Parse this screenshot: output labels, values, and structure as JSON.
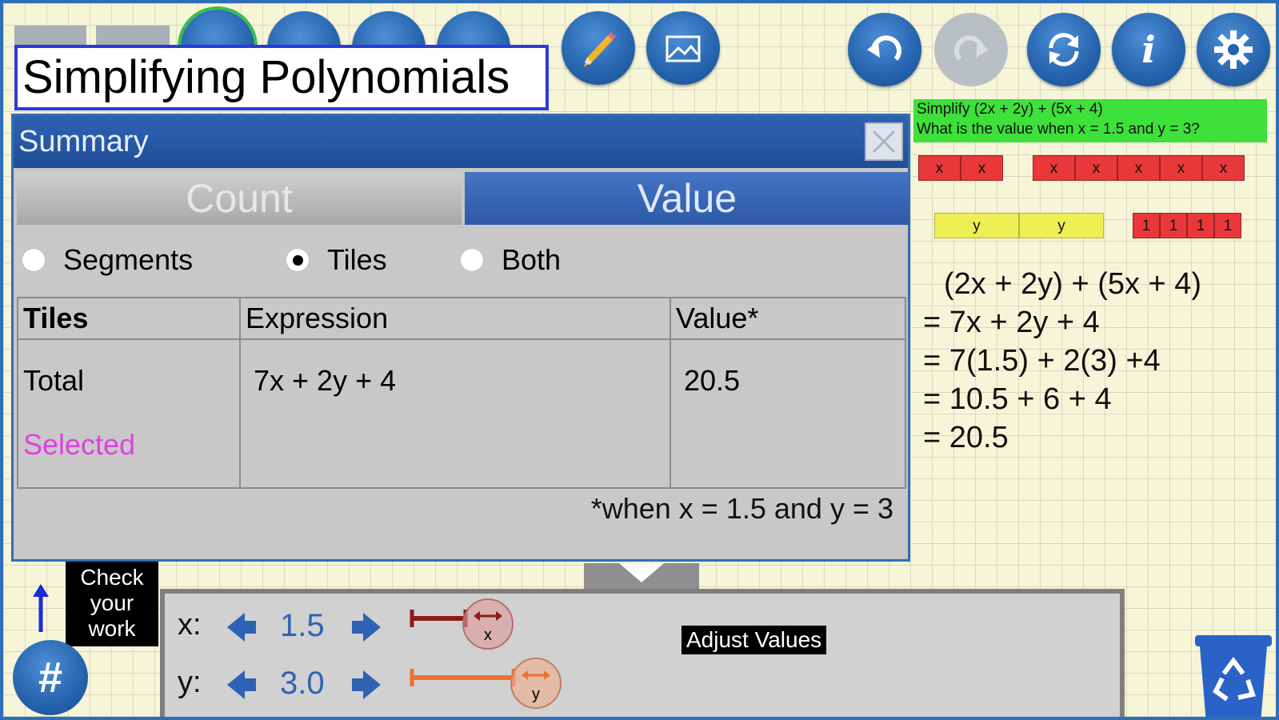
{
  "toolbar": {
    "icons": [
      "pencil-icon",
      "image-icon",
      "undo-icon",
      "redo-icon",
      "refresh-icon",
      "info-icon",
      "settings-icon"
    ],
    "info_label": "i"
  },
  "title": "Simplifying Polynomials",
  "summary": {
    "header": "Summary",
    "tabs": [
      {
        "label": "Count",
        "active": false
      },
      {
        "label": "Value",
        "active": true
      }
    ],
    "radio_options": [
      {
        "label": "Segments",
        "selected": false
      },
      {
        "label": "Tiles",
        "selected": true
      },
      {
        "label": "Both",
        "selected": false
      }
    ],
    "table": {
      "headers": [
        "Tiles",
        "Expression",
        "Value*"
      ],
      "rows": [
        {
          "tiles": "Total",
          "expression": "7x + 2y + 4",
          "value": "20.5"
        },
        {
          "tiles": "Selected",
          "expression": "",
          "value": ""
        }
      ]
    },
    "footnote": "*when x = 1.5 and y = 3"
  },
  "problem": {
    "line1": "Simplify (2x + 2y) + (5x + 4)",
    "line2": "What is the value when x = 1.5 and y = 3?"
  },
  "tiles": {
    "x_label": "x",
    "y_label": "y",
    "one_label": "1"
  },
  "work_lines": [
    "(2x + 2y) + (5x + 4)",
    "= 7x + 2y + 4",
    "= 7(1.5) + 2(3) +4",
    "= 10.5 + 6 + 4",
    "= 20.5"
  ],
  "adjust": {
    "x_label": "x:",
    "x_value": "1.5",
    "y_label": "y:",
    "y_value": "3.0",
    "panel_label": "Adjust Values",
    "x_knob": "x",
    "y_knob": "y"
  },
  "check_work": {
    "line1": "Check",
    "line2": "your",
    "line3": "work"
  },
  "hash_label": "#",
  "colors": {
    "accent": "#2563ad",
    "selected_text": "#e040e0",
    "x_slider": "#8b1a1a",
    "y_slider": "#f07030",
    "problem_bg": "#3ee03a"
  }
}
